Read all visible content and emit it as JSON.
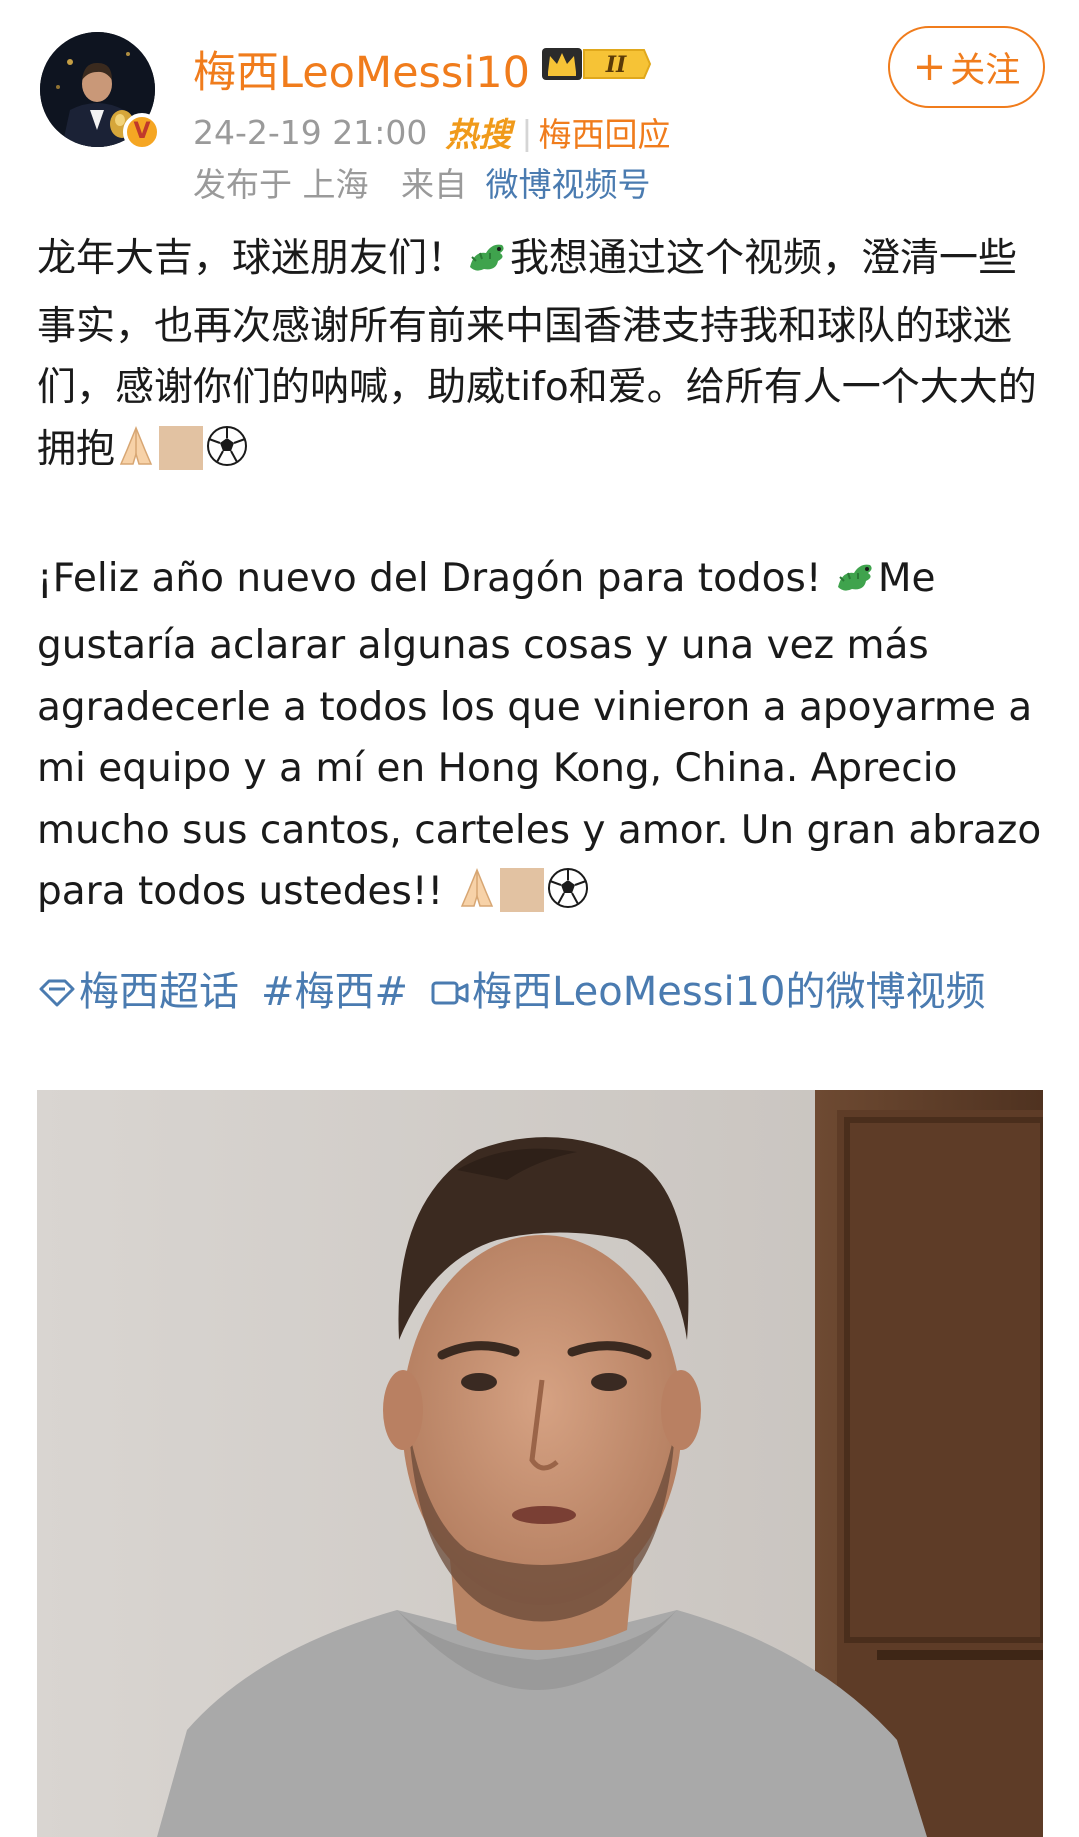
{
  "post": {
    "author": {
      "name": "梅西LeoMessi10",
      "level_badge": "II",
      "verified_mark": "V"
    },
    "follow_label": "关注",
    "follow_icon": "+",
    "timestamp": "24-2-19 21:00",
    "hot_badge": "热搜",
    "hot_topic": "梅西回应",
    "location_text": "发布于 上海",
    "source_prefix": "来自",
    "source_app": "微博视频号",
    "text_zh": {
      "part1": "龙年大吉，球迷朋友们！",
      "part2": "我想通过这个视频，澄清一些事实，也再次感谢所有前来中国香港支持我和球队的球迷们，感谢你们的呐喊，助威tifo和爱。给所有人一个大大的拥抱"
    },
    "text_es": {
      "part1": "¡Feliz año nuevo del Dragón para todos! ",
      "part2": "Me gustaría aclarar algunas cosas y una vez más agradecerle a todos los que vinieron a apoyarme a mi equipo y a mí en Hong Kong, China. Aprecio mucho sus cantos, carteles y amor. Un gran abrazo para todos ustedes!! "
    },
    "emojis": [
      "dragon-emoji",
      "folded-hands-emoji",
      "skin-tone-square",
      "soccer-ball-emoji"
    ],
    "tags": [
      {
        "label": "梅西超话",
        "icon": "super-topic-icon"
      },
      {
        "label": "#梅西#"
      },
      {
        "label": "梅西LeoMessi10的微博视频",
        "icon": "video-icon"
      }
    ],
    "colors": {
      "accent_orange": "#f07c1c",
      "link_blue": "#4a7bb0",
      "meta_gray": "#9a9a9a",
      "text": "#1a1a1a"
    }
  }
}
